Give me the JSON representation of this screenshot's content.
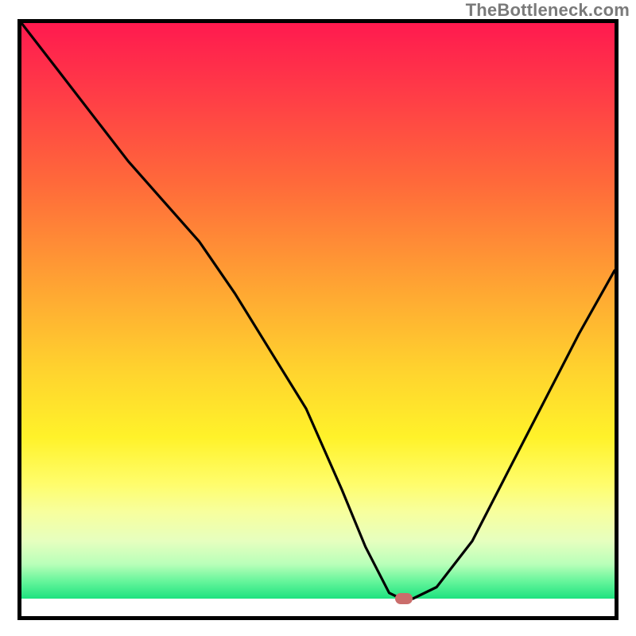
{
  "watermark": "TheBottleneck.com",
  "chart_data": {
    "type": "line",
    "title": "",
    "xlabel": "",
    "ylabel": "",
    "xlim": [
      0,
      100
    ],
    "ylim": [
      0,
      100
    ],
    "x": [
      0,
      6,
      12,
      18,
      24,
      30,
      36,
      42,
      48,
      54,
      58,
      60,
      62,
      64,
      66,
      70,
      76,
      82,
      88,
      94,
      100
    ],
    "values": [
      100,
      92,
      84,
      76,
      69,
      62,
      53,
      43,
      33,
      19,
      9,
      5,
      1,
      0,
      0,
      2,
      10,
      22,
      34,
      46,
      57
    ],
    "series": [
      {
        "name": "bottleneck-curve",
        "x": [
          0,
          6,
          12,
          18,
          24,
          30,
          36,
          42,
          48,
          54,
          58,
          60,
          62,
          64,
          66,
          70,
          76,
          82,
          88,
          94,
          100
        ],
        "values": [
          100,
          92,
          84,
          76,
          69,
          62,
          53,
          43,
          33,
          19,
          9,
          5,
          1,
          0,
          0,
          2,
          10,
          22,
          34,
          46,
          57
        ]
      }
    ],
    "marker": {
      "x": 64.5,
      "y": 0
    },
    "gradient_stops": [
      {
        "pct": 0,
        "color": "#ff1a4f"
      },
      {
        "pct": 12,
        "color": "#ff3b47"
      },
      {
        "pct": 28,
        "color": "#ff6a3a"
      },
      {
        "pct": 45,
        "color": "#ffa233"
      },
      {
        "pct": 60,
        "color": "#ffd22e"
      },
      {
        "pct": 72,
        "color": "#fff22a"
      },
      {
        "pct": 80,
        "color": "#fffd6b"
      },
      {
        "pct": 85,
        "color": "#f7ff9e"
      },
      {
        "pct": 90,
        "color": "#e6ffbf"
      },
      {
        "pct": 94,
        "color": "#b9ffb9"
      },
      {
        "pct": 97,
        "color": "#66f59b"
      },
      {
        "pct": 100,
        "color": "#1de27f"
      }
    ],
    "grid": false,
    "legend": false
  }
}
